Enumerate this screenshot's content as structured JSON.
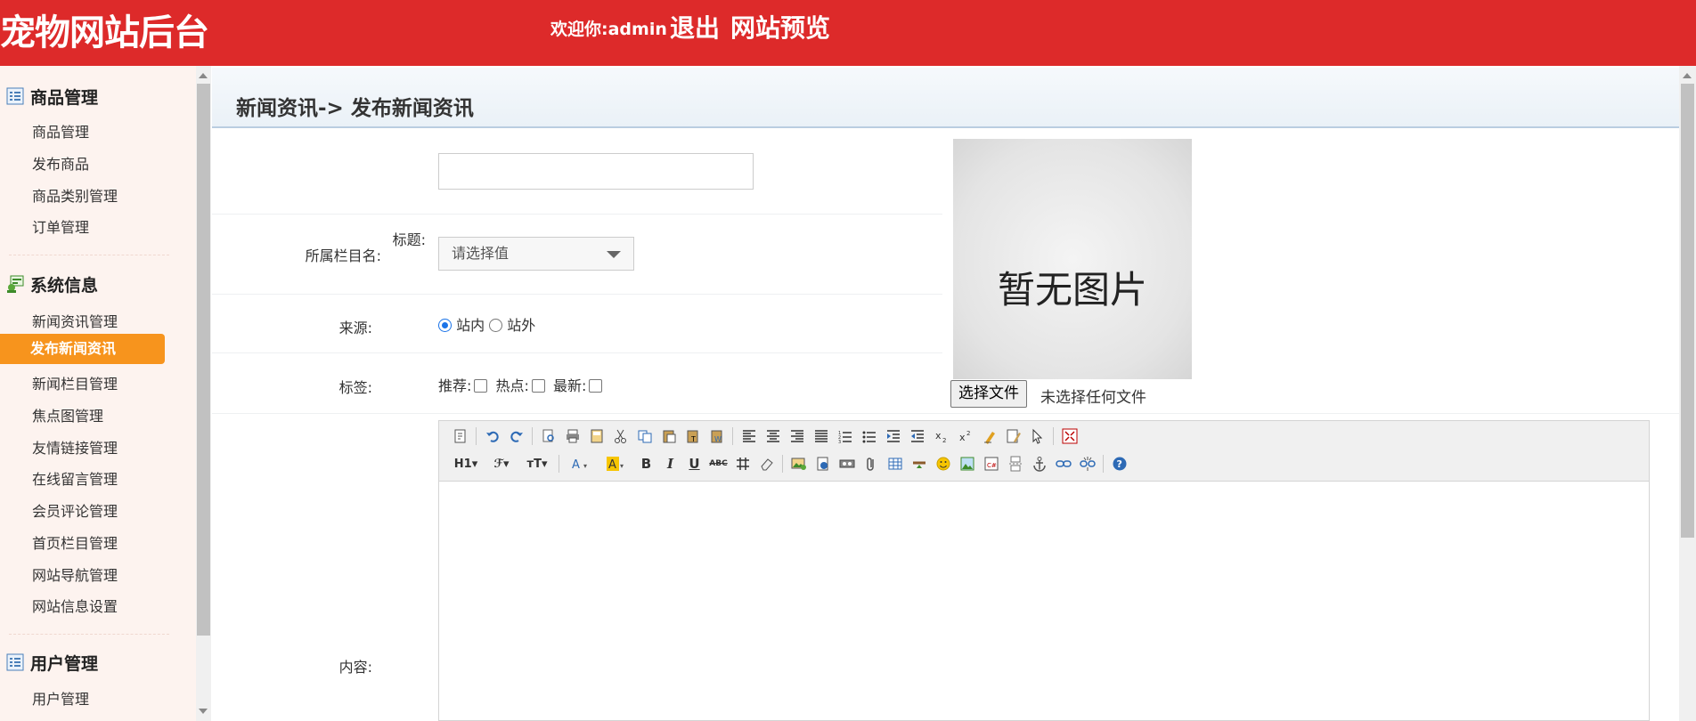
{
  "header": {
    "site_title": "宠物网站后台",
    "welcome": "欢迎你:admin",
    "logout": "退出",
    "preview": "网站预览"
  },
  "sidebar": {
    "groups": [
      {
        "title": "商品管理",
        "icon": "list-icon",
        "items": [
          "商品管理",
          "发布商品",
          "商品类别管理",
          "订单管理"
        ]
      },
      {
        "title": "系统信息",
        "icon": "system-icon",
        "items": [
          "新闻资讯管理",
          "发布新闻资讯",
          "新闻栏目管理",
          "焦点图管理",
          "友情链接管理",
          "在线留言管理",
          "会员评论管理",
          "首页栏目管理",
          "网站导航管理",
          "网站信息设置"
        ]
      },
      {
        "title": "用户管理",
        "icon": "list-icon",
        "items": [
          "用户管理"
        ]
      }
    ],
    "active_item": "发布新闻资讯"
  },
  "main": {
    "breadcrumb": "新闻资讯-> 发布新闻资讯",
    "form": {
      "title_label": "标题:",
      "title_value": "",
      "column_label": "所属栏目名:",
      "column_placeholder": "请选择值",
      "source_label": "来源:",
      "source_options": [
        "站内",
        "站外"
      ],
      "source_selected": "站内",
      "tags_label": "标签:",
      "tags": [
        "推荐:",
        "热点:",
        "最新:"
      ],
      "content_label": "内容:"
    },
    "image": {
      "placeholder_text": "暂无图片",
      "file_button": "选择文件",
      "file_status": "未选择任何文件"
    },
    "editor": {
      "heading_btn": "H1",
      "font_btn": "ℱ",
      "size_btn": "тT",
      "bold": "B",
      "italic": "I",
      "underline": "U",
      "strike": "ABC"
    }
  },
  "colors": {
    "header_bg": "#dd2a2a",
    "sidebar_bg": "#fdf3ef",
    "active_bg": "#f7941d"
  }
}
